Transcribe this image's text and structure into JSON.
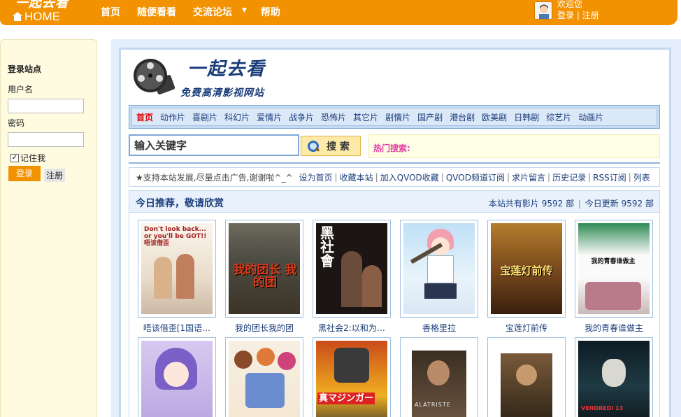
{
  "topbar": {
    "logo_cn": "一起去看",
    "logo_en": "HOME",
    "nav": [
      "首页",
      "随便看看",
      "交流论坛",
      "帮助"
    ],
    "user": {
      "welcome": "欢迎您",
      "login": "登录",
      "sep": "|",
      "register": "注册"
    }
  },
  "login_panel": {
    "title": "登录站点",
    "username_label": "用户名",
    "password_label": "密码",
    "remember_label": "记住我",
    "login_button": "登录",
    "register_button": "注册"
  },
  "site": {
    "name": "一起去看",
    "subtitle": "免费高清影视网站"
  },
  "categories": [
    "首页",
    "动作片",
    "喜剧片",
    "科幻片",
    "爱情片",
    "战争片",
    "恐怖片",
    "其它片",
    "剧情片",
    "国产剧",
    "港台剧",
    "欧美剧",
    "日韩剧",
    "综艺片",
    "动画片"
  ],
  "search": {
    "value": "输入关键字",
    "button": "搜 索",
    "hot_label": "热门搜索:"
  },
  "notice": {
    "text": "★支持本站发展,尽量点击广告,谢谢啦^_^",
    "links": [
      "设为首页",
      "收藏本站",
      "加入QVOD收藏",
      "QVOD频道订阅",
      "求片留言",
      "历史记录",
      "RSS订阅",
      "列表"
    ]
  },
  "recommend": {
    "title": "今日推荐，敬请欣赏",
    "total_label": "本站共有影片",
    "total": "9592 部",
    "today_label": "今日更新",
    "today": "9592 部"
  },
  "movies_row1": [
    {
      "title": "唔该借歪[1国语…",
      "poster_text": "Don't look back... or you'll be GOT!! 唔该借歪"
    },
    {
      "title": "我的团长我的团",
      "poster_text": "我的团长 我的团"
    },
    {
      "title": "黑社会2:以和为…",
      "poster_text": "黑社會"
    },
    {
      "title": "香格里拉",
      "poster_text": ""
    },
    {
      "title": "宝莲灯前传",
      "poster_text": "宝莲灯前传"
    },
    {
      "title": "我的青春谁做主",
      "poster_text": "我的青春谁做主"
    }
  ],
  "movies_row2": [
    {
      "title": "",
      "poster_text": ""
    },
    {
      "title": "",
      "poster_text": ""
    },
    {
      "title": "",
      "poster_text": "真マジンガー"
    },
    {
      "title": "",
      "poster_text": "ALATRISTE"
    },
    {
      "title": "",
      "poster_text": ""
    },
    {
      "title": "",
      "poster_text": "VENDREDI 13"
    }
  ],
  "colors": {
    "brand_orange": "#f39200",
    "link_blue": "#1a3d7a",
    "hot_pink": "#e23fa3",
    "active_red": "#dd0000"
  }
}
